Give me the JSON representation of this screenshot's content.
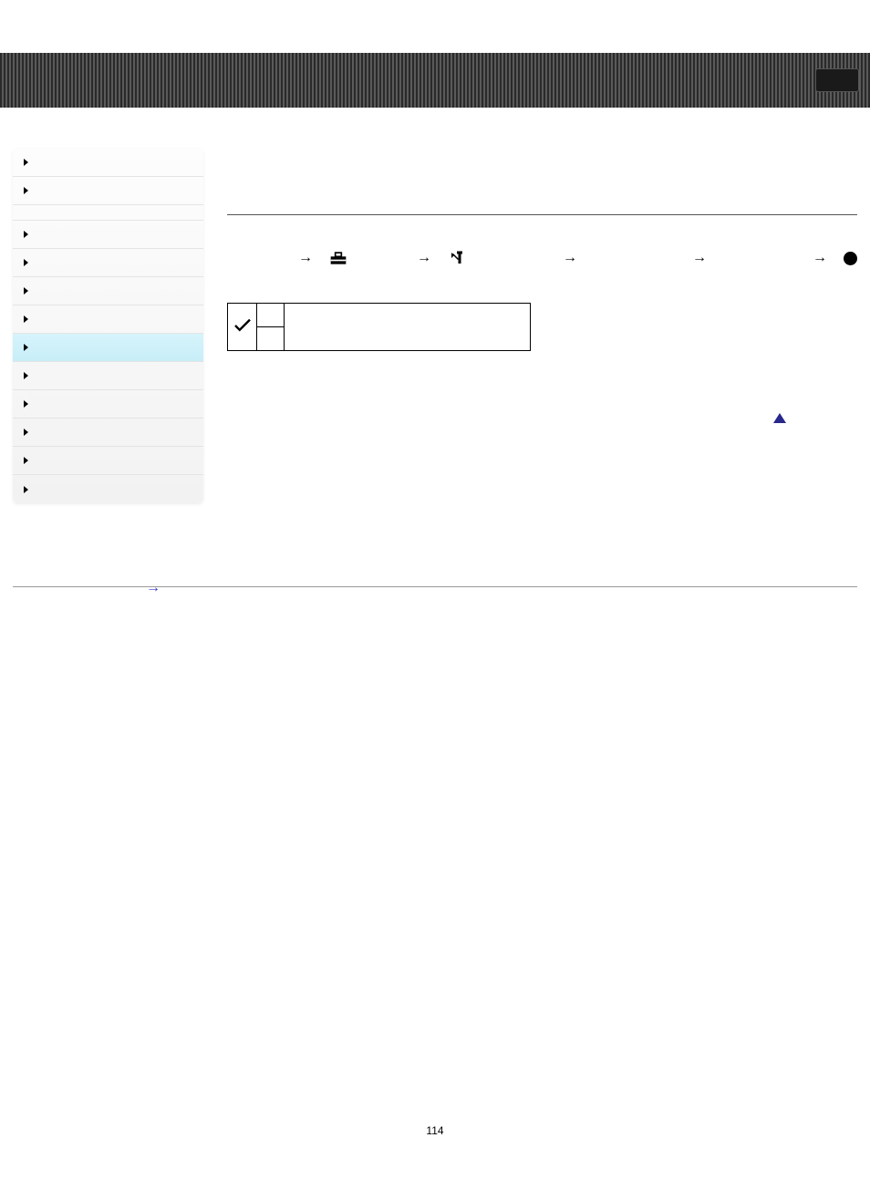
{
  "header": {
    "box_label": ""
  },
  "sidebar": {
    "items": [
      {
        "kind": "item"
      },
      {
        "kind": "item"
      },
      {
        "kind": "gap"
      },
      {
        "kind": "item"
      },
      {
        "kind": "item"
      },
      {
        "kind": "item"
      },
      {
        "kind": "item"
      },
      {
        "kind": "item",
        "active": true
      },
      {
        "kind": "item"
      },
      {
        "kind": "item"
      },
      {
        "kind": "item"
      },
      {
        "kind": "item"
      },
      {
        "kind": "item"
      }
    ]
  },
  "breadcrumb": {
    "steps": [
      {
        "icon": "arrow"
      },
      {
        "icon": "toolbox"
      },
      {
        "icon": "arrow"
      },
      {
        "icon": "tools"
      },
      {
        "icon": "arrow"
      },
      {
        "icon": "arrow"
      },
      {
        "icon": "arrow"
      },
      {
        "icon": "dot"
      }
    ]
  },
  "table": {
    "rows": [
      {
        "check": true,
        "a": "",
        "b": ""
      },
      {
        "check": false,
        "a": "",
        "b": ""
      }
    ]
  },
  "footer": {
    "page_number": "114"
  }
}
